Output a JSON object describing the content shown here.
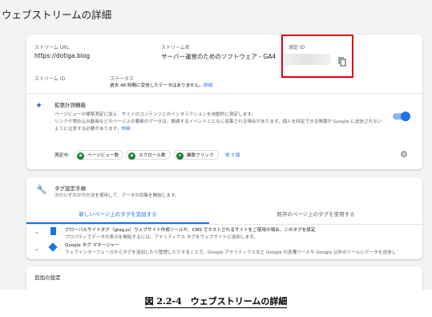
{
  "page": {
    "title": "ウェブストリームの詳細"
  },
  "stream": {
    "url_label": "ストリーム URL",
    "url_value": "https://dotiga.blog",
    "name_label": "ストリーム名",
    "name_value": "サーバー運営のためのソフトウェア - GA4",
    "measurement_id_label": "測定 ID",
    "id_label": "ストリーム ID",
    "status_label": "ステータス",
    "status_text": "過去 48 時間に受信したデータはありません。",
    "status_link": "詳細"
  },
  "enhanced": {
    "title": "拡張計測機能",
    "description_1": "ページビューの標準測定に加え、サイトのコンテンツとのインタラクションを自動的に測定します。",
    "description_2": "リンクや埋め込み動画などのページ上の要素のデータは、関連するイベントとともに収集される場合があります。個人を特定できる情報が Google に送信されない",
    "description_3": "ように注意する必要があります。",
    "description_link": "詳細",
    "measuring_label": "測定中:",
    "chips": [
      "ページビュー数",
      "スクロール数",
      "離脱クリック"
    ],
    "more_link": "他 3 個"
  },
  "tagging": {
    "title": "タグ設定手順",
    "subtitle": "次のいずれかの方法を使用して、データの収集を開始します。",
    "tab_new": "新しいページ上のタグを追加する",
    "tab_existing": "既存のページ上のタグを使用する",
    "items": [
      {
        "title": "グローバルサイトタグ（gtag.js）ウェブサイト作成ツールや、CMS でホストされるサイトをご使用の場合、このタグを設定",
        "desc": "プロパティでデータの表示を開始するには、アナリティクス タグをウェブサイトに追加します。"
      },
      {
        "title": "Google タグ マネージャー",
        "desc": "ウェブインターフェースからタグを追加したり管理したりすることで、Google アナリティクスなど Google の各種ツールや Google 以外のツールにデータを送信し"
      }
    ]
  },
  "additional": {
    "title": "追加の設定"
  },
  "caption": "図 2.2-4　ウェブストリームの詳細",
  "colors": {
    "accent": "#1a73e8",
    "highlight": "#e1000f",
    "chip_icon": "#188038"
  }
}
